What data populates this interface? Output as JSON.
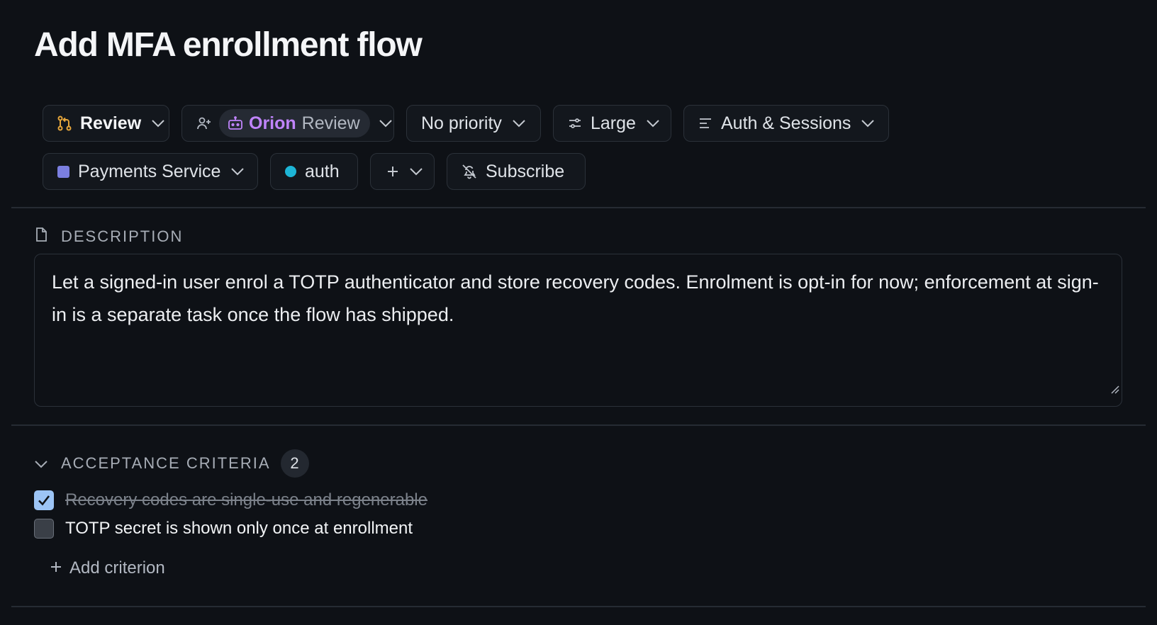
{
  "task": {
    "title": "Add MFA enrollment flow"
  },
  "properties": {
    "status": {
      "label": "Review",
      "icon": "git-pull-request-icon",
      "color": "#e5a53b"
    },
    "assignee": {
      "name": "Orion",
      "role": "Review",
      "icon": "bot-icon",
      "add_icon": "add-user-icon"
    },
    "priority": {
      "label": "No priority"
    },
    "size": {
      "label": "Large",
      "icon": "sliders-icon"
    },
    "epic": {
      "label": "Auth & Sessions",
      "icon": "align-left-icon"
    },
    "project": {
      "label": "Payments Service",
      "color": "#7b7fe0"
    },
    "label_tag": {
      "label": "auth",
      "color": "#1db5d6"
    },
    "subscribe": {
      "label": "Subscribe",
      "icon": "bell-off-icon"
    }
  },
  "description": {
    "heading": "DESCRIPTION",
    "text": "Let a signed-in user enrol a TOTP authenticator and store recovery codes. Enrolment is opt-in for now; enforcement at sign-in is a separate task once the flow has shipped."
  },
  "acceptance": {
    "heading": "ACCEPTANCE CRITERIA",
    "count": "2",
    "items": [
      {
        "text": "Recovery codes are single-use and regenerable",
        "checked": true
      },
      {
        "text": "TOTP secret is shown only once at enrollment",
        "checked": false
      }
    ],
    "add_label": "Add criterion"
  }
}
